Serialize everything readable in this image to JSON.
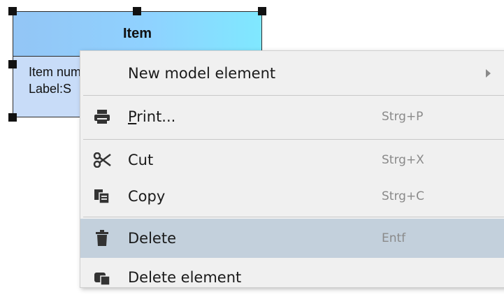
{
  "diagram": {
    "class_box": {
      "title": "Item",
      "attribute_line_1": "Item number:",
      "attribute_line_2": "Label:S"
    }
  },
  "context_menu": {
    "items": [
      {
        "label": "New model element",
        "shortcut": "",
        "has_submenu": true
      },
      {
        "label_prefix": "P",
        "label_rest": "rint...",
        "shortcut": "Strg+P"
      },
      {
        "label": "Cut",
        "shortcut": "Strg+X"
      },
      {
        "label": "Copy",
        "shortcut": "Strg+C"
      },
      {
        "label": "Delete",
        "shortcut": "Entf",
        "selected": true
      },
      {
        "label": "Delete element",
        "shortcut": ""
      }
    ]
  },
  "colors": {
    "menu_background": "#f0f0f0",
    "selected_item": "#c3d0dc",
    "class_header_gradient_start": "#93c5f5",
    "class_header_gradient_end": "#7fe8ff",
    "class_body": "#c8dcf8",
    "shortcut_text": "#8a8a8a"
  },
  "icons": {
    "print": "printer-icon",
    "cut": "scissors-icon",
    "copy": "copy-icon",
    "delete": "trash-icon",
    "delete_element": "delete-element-icon"
  }
}
